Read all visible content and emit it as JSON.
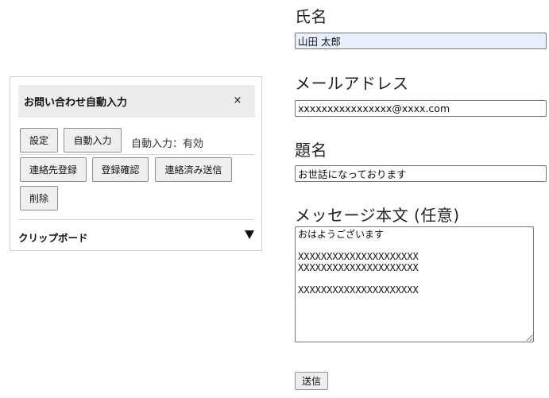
{
  "panel": {
    "title": "お問い合わせ自動入力",
    "close_label": "×",
    "buttons": {
      "settings": "設定",
      "autofill": "自動入力",
      "register_contact": "連絡先登録",
      "confirm_registration": "登録確認",
      "send_contacted": "連絡済み送信",
      "delete": "削除"
    },
    "autofill_status": "自動入力：有効",
    "clipboard_label": "クリップボード",
    "clipboard_toggle_icon": "triangle-down-icon"
  },
  "form": {
    "name": {
      "label": "氏名",
      "value": "山田 太郎"
    },
    "email": {
      "label": "メールアドレス",
      "value": "xxxxxxxxxxxxxxxx@xxxx.com"
    },
    "subject": {
      "label": "題名",
      "value": "お世話になっております"
    },
    "message": {
      "label": "メッセージ本文 (任意)",
      "value": "おはようございます\n\nXXXXXXXXXXXXXXXXXXXXX\nXXXXXXXXXXXXXXXXXXXXX\n\nXXXXXXXXXXXXXXXXXXXXX"
    },
    "submit_label": "送信"
  },
  "colors": {
    "autofill_background": "#e8f0fe",
    "panel_header_background": "#ececec",
    "button_background": "#efefef"
  }
}
